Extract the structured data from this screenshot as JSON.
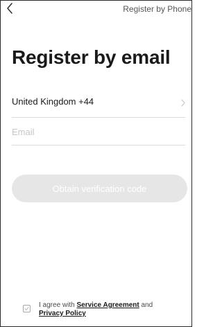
{
  "header": {
    "back_icon": "chevron-left-icon",
    "switch_label": "Register by Phone"
  },
  "page": {
    "title": "Register by email"
  },
  "country": {
    "value": "United Kingdom +44",
    "chevron_icon": "chevron-right-icon"
  },
  "email": {
    "value": "",
    "placeholder": "Email"
  },
  "verify_button": {
    "label": "Obtain verification code",
    "state": "disabled"
  },
  "agreement": {
    "checked": false,
    "prefix": "I agree with",
    "service_link": "Service Agreement",
    "conjunction": "and",
    "privacy_link": "Privacy Policy"
  },
  "colors": {
    "button_disabled_bg": "#e6e6e6",
    "divider": "#dcdcdc",
    "placeholder": "#c6c6c6"
  }
}
